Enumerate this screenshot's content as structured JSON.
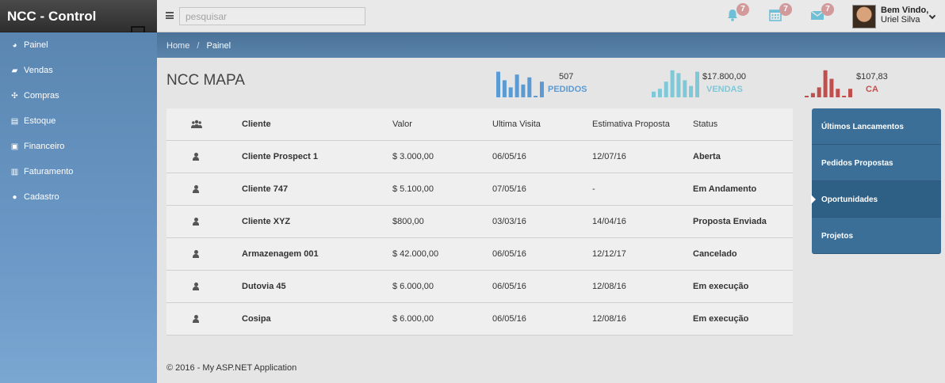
{
  "brand": {
    "title": "NCC - Control"
  },
  "topbar": {
    "search_placeholder": "pesquisar",
    "notifications": [
      {
        "icon": "bell-icon",
        "count": "7"
      },
      {
        "icon": "calendar-icon",
        "count": "7"
      },
      {
        "icon": "envelope-icon",
        "count": "7"
      }
    ],
    "user": {
      "welcome": "Bem Vindo,",
      "name": "Uriel Silva"
    }
  },
  "sidebar": {
    "items": [
      {
        "label": "Painel",
        "icon": "dashboard-icon"
      },
      {
        "label": "Vendas",
        "icon": "cart-icon"
      },
      {
        "label": "Compras",
        "icon": "crosshair-icon"
      },
      {
        "label": "Estoque",
        "icon": "storage-icon"
      },
      {
        "label": "Financeiro",
        "icon": "money-icon"
      },
      {
        "label": "Faturamento",
        "icon": "barcode-icon"
      },
      {
        "label": "Cadastro",
        "icon": "map-marker-icon"
      }
    ]
  },
  "breadcrumb": {
    "home": "Home",
    "separator": "/",
    "current": "Painel"
  },
  "page": {
    "title": "NCC MAPA"
  },
  "stats": [
    {
      "value": "507",
      "label": "PEDIDOS",
      "color": "#5b9bd5",
      "bars": [
        0.9,
        0.6,
        0.35,
        0.8,
        0.45,
        0.7,
        0.05,
        0.55
      ]
    },
    {
      "value": "$17.800,00",
      "label": "VENDAS",
      "color": "#7ec8d8",
      "bars": [
        0.2,
        0.3,
        0.55,
        0.95,
        0.85,
        0.6,
        0.4,
        0.9
      ]
    },
    {
      "value": "$107,83",
      "label": "CA",
      "color": "#c0504d",
      "bars": [
        0.05,
        0.15,
        0.35,
        0.95,
        0.65,
        0.3,
        0.05,
        0.3
      ]
    }
  ],
  "table": {
    "headers": {
      "icon": "users-icon",
      "cliente": "Cliente",
      "valor": "Valor",
      "visita": "Ultima Visita",
      "estimativa": "Estimativa Proposta",
      "status": "Status"
    },
    "rows": [
      {
        "cliente": "Cliente Prospect 1",
        "valor": "$ 3.000,00",
        "visita": "06/05/16",
        "estimativa": "12/07/16",
        "status": "Aberta"
      },
      {
        "cliente": "Cliente 747",
        "valor": "$ 5.100,00",
        "visita": "07/05/16",
        "estimativa": "-",
        "status": "Em Andamento"
      },
      {
        "cliente": "Cliente XYZ",
        "valor": "$800,00",
        "visita": "03/03/16",
        "estimativa": "14/04/16",
        "status": "Proposta Enviada"
      },
      {
        "cliente": "Armazenagem 001",
        "valor": "$ 42.000,00",
        "visita": "06/05/16",
        "estimativa": "12/12/17",
        "status": "Cancelado"
      },
      {
        "cliente": "Dutovia 45",
        "valor": "$ 6.000,00",
        "visita": "06/05/16",
        "estimativa": "12/08/16",
        "status": "Em execução"
      },
      {
        "cliente": "Cosipa",
        "valor": "$ 6.000,00",
        "visita": "06/05/16",
        "estimativa": "12/08/16",
        "status": "Em execução"
      }
    ]
  },
  "tabs": [
    {
      "label": "Últimos Lancamentos",
      "active": false
    },
    {
      "label": "Pedidos Propostas",
      "active": false
    },
    {
      "label": "Oportunidades",
      "active": true
    },
    {
      "label": "Projetos",
      "active": false
    }
  ],
  "footer": {
    "text": "© 2016 - My ASP.NET Application"
  }
}
